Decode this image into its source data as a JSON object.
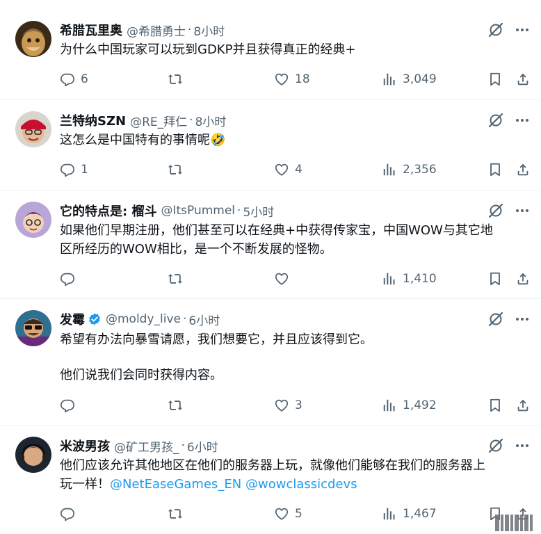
{
  "tweets": [
    {
      "name": "希腊瓦里奥",
      "handle": "@希腊勇士",
      "time": "8小时",
      "verified": false,
      "avatar_icon": "warrior-avatar-icon",
      "lines": [
        "为什么中国玩家可以玩到GDKP并且获得真正的经典+"
      ],
      "replies": "6",
      "retweets": "",
      "likes": "18",
      "views": "3,049"
    },
    {
      "name": "兰特纳SZN",
      "handle": "@RE_拜仁",
      "time": "8小时",
      "verified": false,
      "avatar_icon": "red-cap-avatar-icon",
      "lines": [
        "这怎么是中国特有的事情呢🤣"
      ],
      "replies": "1",
      "retweets": "",
      "likes": "4",
      "views": "2,356"
    },
    {
      "name": "它的特点是: 榴斗",
      "handle": "@ItsPummel",
      "time": "5小时",
      "verified": false,
      "avatar_icon": "cartoon-avatar-icon",
      "lines": [
        "如果他们早期注册，他们甚至可以在经典+中获得传家宝，中国WOW与其它地",
        "区所经历的WOW相比，是一个不断发展的怪物。"
      ],
      "replies": "",
      "retweets": "",
      "likes": "",
      "views": "1,410"
    },
    {
      "name": "发霉",
      "handle": "@moldy_live",
      "time": "6小时",
      "verified": true,
      "avatar_icon": "sunglasses-avatar-icon",
      "paragraphs": [
        "希望有办法向暴雪请愿，我们想要它，并且应该得到它。",
        "他们说我们会同时获得内容。"
      ],
      "replies": "",
      "retweets": "",
      "likes": "3",
      "views": "1,492"
    },
    {
      "name": "米波男孩",
      "handle": "@矿工男孩_",
      "time": "6小时",
      "verified": false,
      "avatar_icon": "headset-avatar-icon",
      "line1": "他们应该允许其他地区在他们的服务器上玩，就像他们能够在我们的服务器上",
      "line2_text": "玩一样！",
      "mention1": "@NetEaseGames_EN",
      "mention2": "@wowclassicdevs",
      "replies": "",
      "retweets": "",
      "likes": "5",
      "views": "1,467"
    }
  ],
  "colors": {
    "accent": "#1d9bf0",
    "muted": "#536471",
    "text": "#0f1419",
    "divider": "#eff3f4"
  },
  "icons": [
    "grok-icon",
    "more-icon",
    "reply-icon",
    "retweet-icon",
    "like-icon",
    "views-icon",
    "bookmark-icon",
    "share-icon",
    "verified-badge-icon"
  ]
}
